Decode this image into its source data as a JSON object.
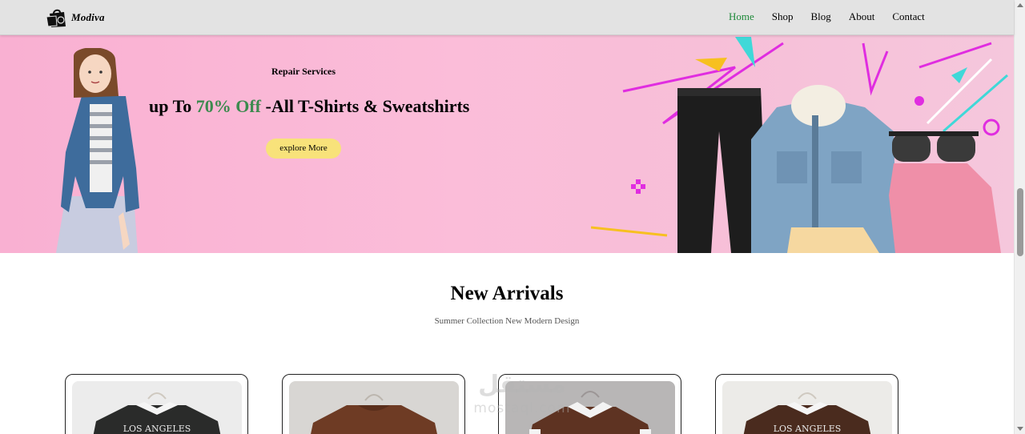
{
  "brand": {
    "name": "Modiva"
  },
  "nav": {
    "items": [
      {
        "label": "Home",
        "active": true
      },
      {
        "label": "Shop",
        "active": false
      },
      {
        "label": "Blog",
        "active": false
      },
      {
        "label": "About",
        "active": false
      },
      {
        "label": "Contact",
        "active": false
      }
    ]
  },
  "hero": {
    "kicker": "Repair Services",
    "title_pre": "up To ",
    "title_highlight": "70% Off",
    "title_post": " -All T-Shirts & Sweatshirts",
    "button_label": "explore More",
    "highlight_color": "#3c8a4e",
    "button_color": "#f8e27a"
  },
  "arrivals": {
    "title": "New Arrivals",
    "subtitle": "Summer Collection New Modern Design",
    "products": [
      {
        "image": "black-los-angeles-sweatshirt",
        "print": "LOS ANGELES"
      },
      {
        "image": "brown-knit-sweater",
        "print": ""
      },
      {
        "image": "brown-cable-knit-collar-sweater",
        "print": ""
      },
      {
        "image": "brown-los-angeles-sweatshirt",
        "print": "LOS ANGELES"
      }
    ]
  },
  "watermark": {
    "line1": "مستقل",
    "line2": "mostaql.com"
  },
  "colors": {
    "nav_active": "#1f8a3a",
    "header_bg": "#e3e3e3"
  }
}
